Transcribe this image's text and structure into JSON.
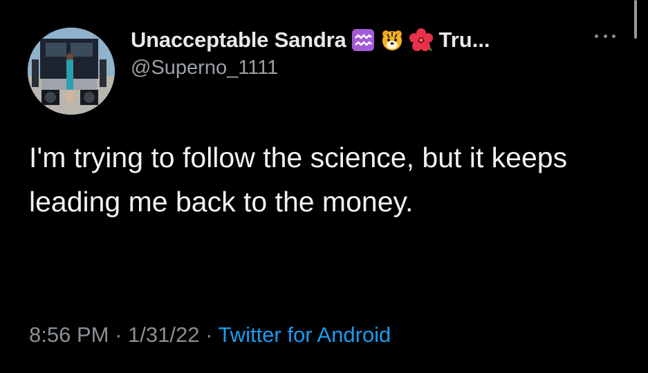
{
  "tweet": {
    "display_name": "Unacceptable Sandra",
    "name_suffix": "Tru...",
    "handle": "@Superno_1111",
    "emojis": [
      "aquarius-icon",
      "tiger-face-icon",
      "hibiscus-icon"
    ],
    "text": "I'm trying to follow the science, but it keeps leading me back to the money.",
    "time": "8:56 PM",
    "separator": " · ",
    "date": "1/31/22",
    "source": "Twitter for Android"
  },
  "colors": {
    "background": "#000000",
    "text": "#e7e9ea",
    "muted": "#8b9096",
    "link": "#1d9bf0"
  }
}
